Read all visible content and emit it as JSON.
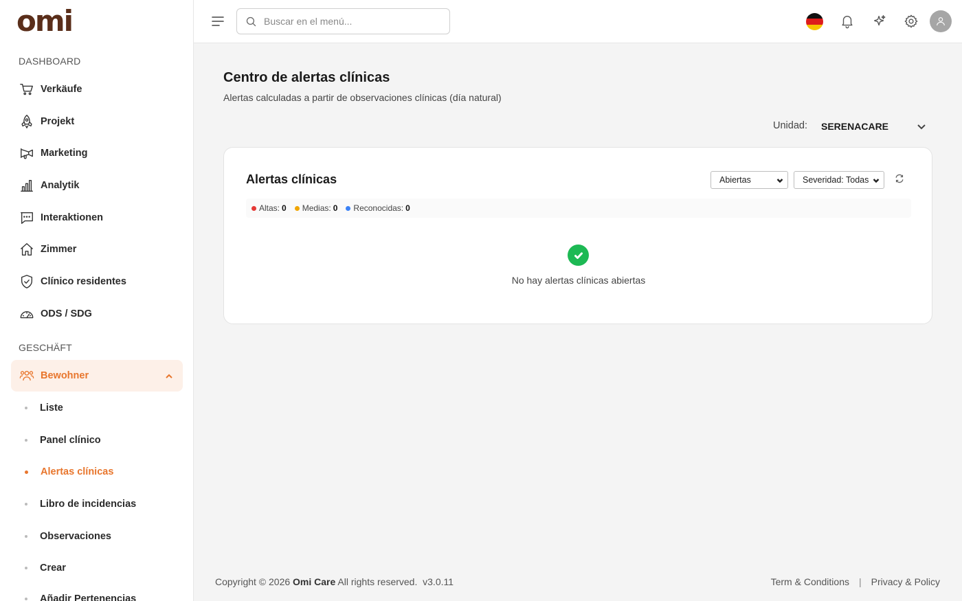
{
  "app": {
    "logo": "omi"
  },
  "sidebar": {
    "section_dashboard": "DASHBOARD",
    "section_business": "GESCHÄFT",
    "dashboard_items": [
      {
        "label": "Verkäufe",
        "icon": "cart-icon"
      },
      {
        "label": "Projekt",
        "icon": "rocket-icon"
      },
      {
        "label": "Marketing",
        "icon": "megaphone-icon"
      },
      {
        "label": "Analytik",
        "icon": "bar-chart-icon"
      },
      {
        "label": "Interaktionen",
        "icon": "chat-icon"
      },
      {
        "label": "Zimmer",
        "icon": "home-icon"
      },
      {
        "label": "Clínico residentes",
        "icon": "shield-check-icon"
      },
      {
        "label": "ODS / SDG",
        "icon": "gauge-icon"
      }
    ],
    "bewohner": {
      "label": "Bewohner",
      "icon": "users-icon"
    },
    "sub_items": [
      {
        "label": "Liste"
      },
      {
        "label": "Panel clínico"
      },
      {
        "label": "Alertas clínicas"
      },
      {
        "label": "Libro de incidencias"
      },
      {
        "label": "Observaciones"
      },
      {
        "label": "Crear"
      },
      {
        "label": "Añadir Pertenencias"
      }
    ]
  },
  "topbar": {
    "search_placeholder": "Buscar en el menú..."
  },
  "page": {
    "title": "Centro de alertas clínicas",
    "subtitle": "Alertas calculadas a partir de observaciones clínicas (día natural)",
    "unit_label": "Unidad:",
    "unit_value": "SERENACARE"
  },
  "card": {
    "title": "Alertas clínicas",
    "status_filter": "Abiertas",
    "severity_filter": "Severidad: Todas",
    "summary": [
      {
        "label": "Altas:",
        "count": "0",
        "color": "#e53935"
      },
      {
        "label": "Medias:",
        "count": "0",
        "color": "#f0a500"
      },
      {
        "label": "Reconocidas:",
        "count": "0",
        "color": "#3b82f6"
      }
    ],
    "empty_text": "No hay alertas clínicas abiertas"
  },
  "footer": {
    "copyright_prefix": "Copyright © 2026",
    "brand": "Omi Care",
    "copyright_suffix": "All rights reserved.",
    "version": "v3.0.11",
    "terms": "Term & Conditions",
    "separator": "|",
    "privacy": "Privacy & Policy"
  },
  "colors": {
    "accent": "#e8762d",
    "brand": "#5a2e1a",
    "success": "#1db954"
  }
}
